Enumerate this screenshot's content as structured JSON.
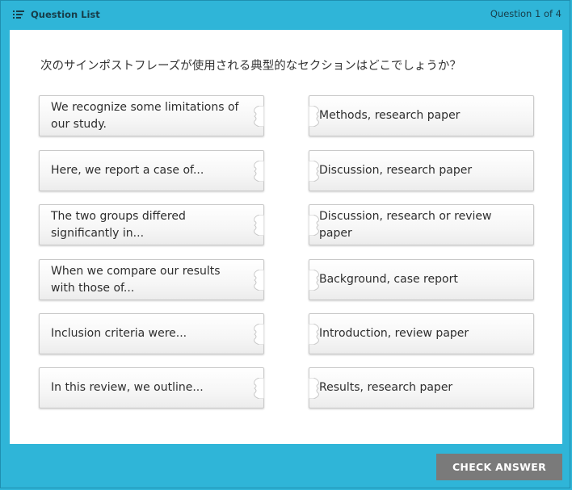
{
  "header": {
    "question_list_label": "Question List",
    "counter": "Question 1 of 4",
    "icon": "list-icon"
  },
  "question": {
    "text": "次のサインポストフレーズが使用される典型的なセクションはどこでしょうか？"
  },
  "left_items": [
    {
      "text": "We recognize some limitations of our study."
    },
    {
      "text": "Here, we report a case of..."
    },
    {
      "text": "The two groups differed significantly in..."
    },
    {
      "text": "When we compare our results with those of..."
    },
    {
      "text": "Inclusion criteria were..."
    },
    {
      "text": "In this review, we outline..."
    }
  ],
  "right_items": [
    {
      "text": "Methods, research paper"
    },
    {
      "text": "Discussion, research paper"
    },
    {
      "text": "Discussion, research or review paper"
    },
    {
      "text": "Background, case report"
    },
    {
      "text": "Introduction, review paper"
    },
    {
      "text": "Results, research paper"
    }
  ],
  "footer": {
    "check_answer_label": "CHECK ANSWER"
  },
  "colors": {
    "background": "#2fb5d8",
    "button": "#7a7a7a"
  }
}
